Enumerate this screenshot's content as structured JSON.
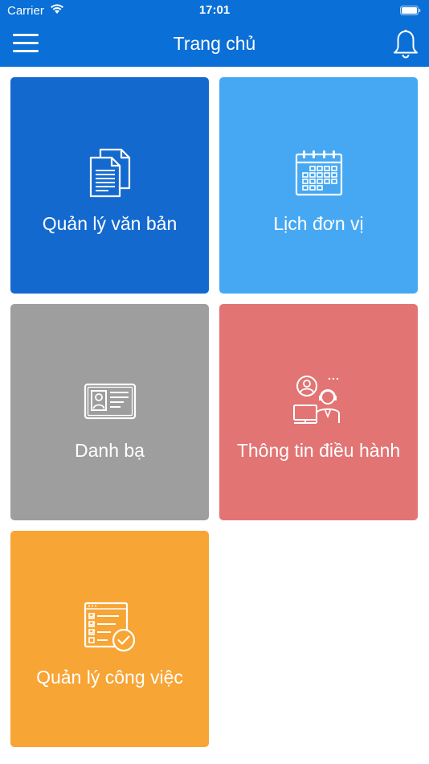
{
  "status_bar": {
    "carrier": "Carrier",
    "time": "17:01"
  },
  "nav": {
    "title": "Trang chủ",
    "menu_icon": "hamburger-menu-icon",
    "bell_icon": "bell-icon"
  },
  "tiles": [
    {
      "label": "Quản lý văn bản",
      "color": "#1469cf",
      "icon": "documents-icon"
    },
    {
      "label": "Lịch đơn vị",
      "color": "#46a8f2",
      "icon": "calendar-icon"
    },
    {
      "label": "Danh bạ",
      "color": "#9e9e9e",
      "icon": "contact-card-icon"
    },
    {
      "label": "Thông tin điều hành",
      "color": "#e27474",
      "icon": "operator-icon"
    },
    {
      "label": "Quản lý công việc",
      "color": "#f7a535",
      "icon": "task-checklist-icon"
    }
  ],
  "colors": {
    "header_blue": "#0a6fd6",
    "background": "#ffffff"
  }
}
